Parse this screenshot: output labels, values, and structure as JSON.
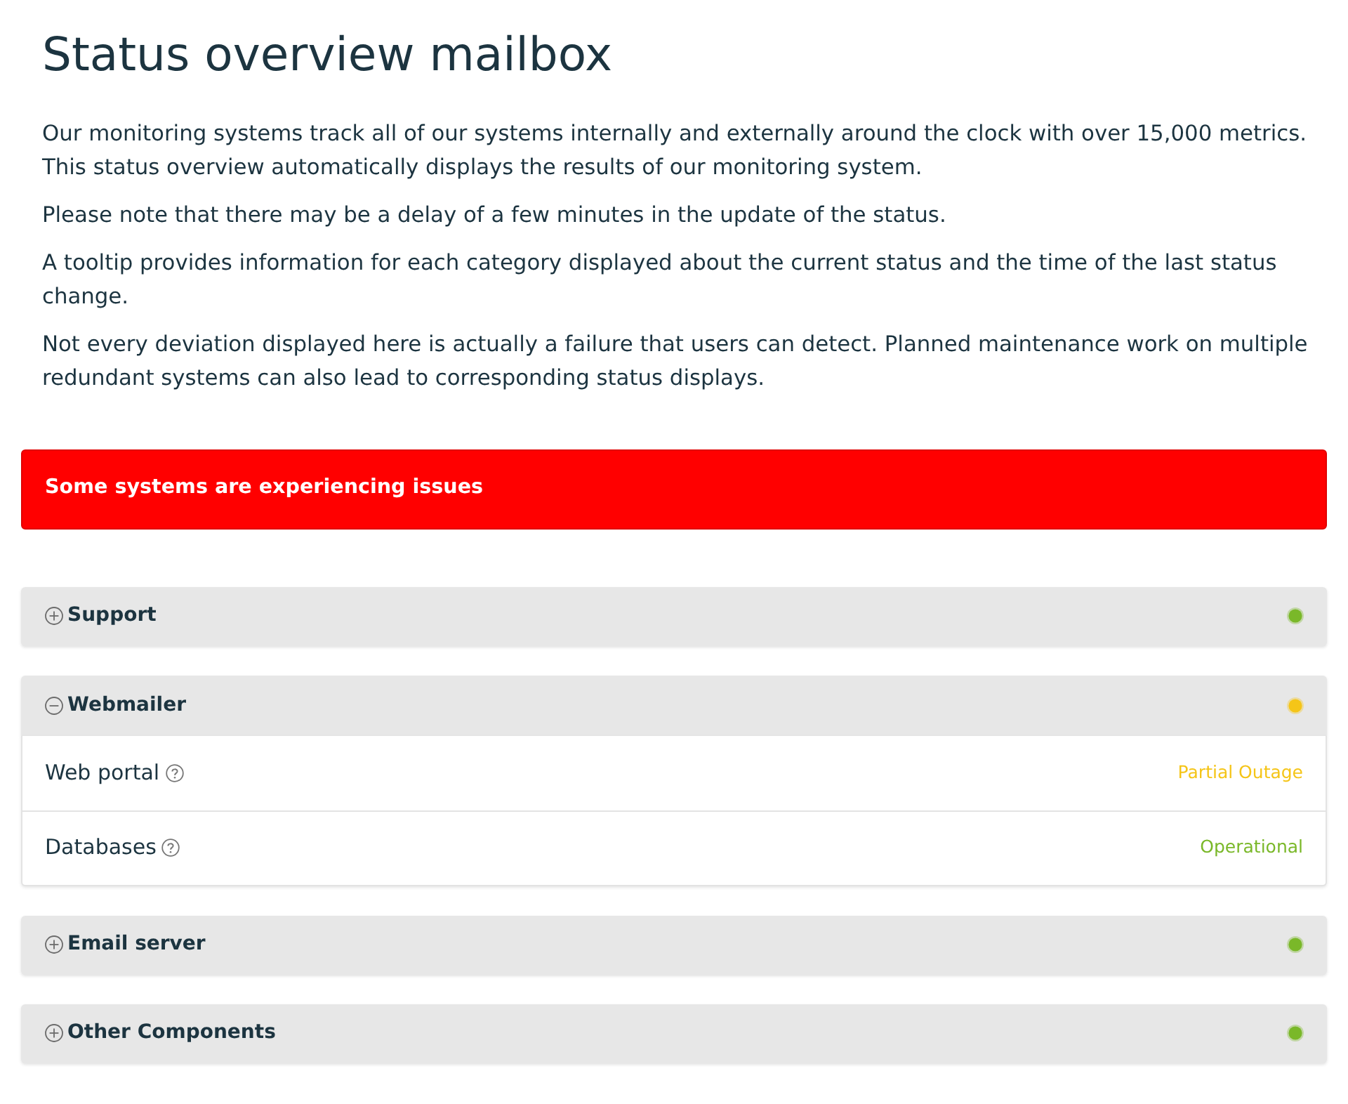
{
  "title": "Status overview mailbox",
  "paragraphs": [
    "Our monitoring systems track all of our systems internally and externally around the clock with over 15,000 metrics. This status overview automatically displays the results of our monitoring system.",
    "Please note that there may be a delay of a few minutes in the update of the status.",
    "A tooltip provides information for each category displayed about the current status and the time of the last status change.",
    "Not every deviation displayed here is actually a failure that users can detect. Planned maintenance work on multiple redundant systems can also lead to corresponding status displays."
  ],
  "alert": {
    "text": "Some systems are experiencing issues"
  },
  "groups": [
    {
      "name": "Support",
      "expanded": false,
      "color": "#7ab829"
    },
    {
      "name": "Webmailer",
      "expanded": true,
      "color": "#f5c518",
      "components": [
        {
          "name": "Web portal",
          "status": "Partial Outage",
          "color": "#f5c518"
        },
        {
          "name": "Databases",
          "status": "Operational",
          "color": "#7ab829"
        }
      ]
    },
    {
      "name": "Email server",
      "expanded": false,
      "color": "#7ab829"
    },
    {
      "name": "Other Components",
      "expanded": false,
      "color": "#7ab829"
    }
  ]
}
